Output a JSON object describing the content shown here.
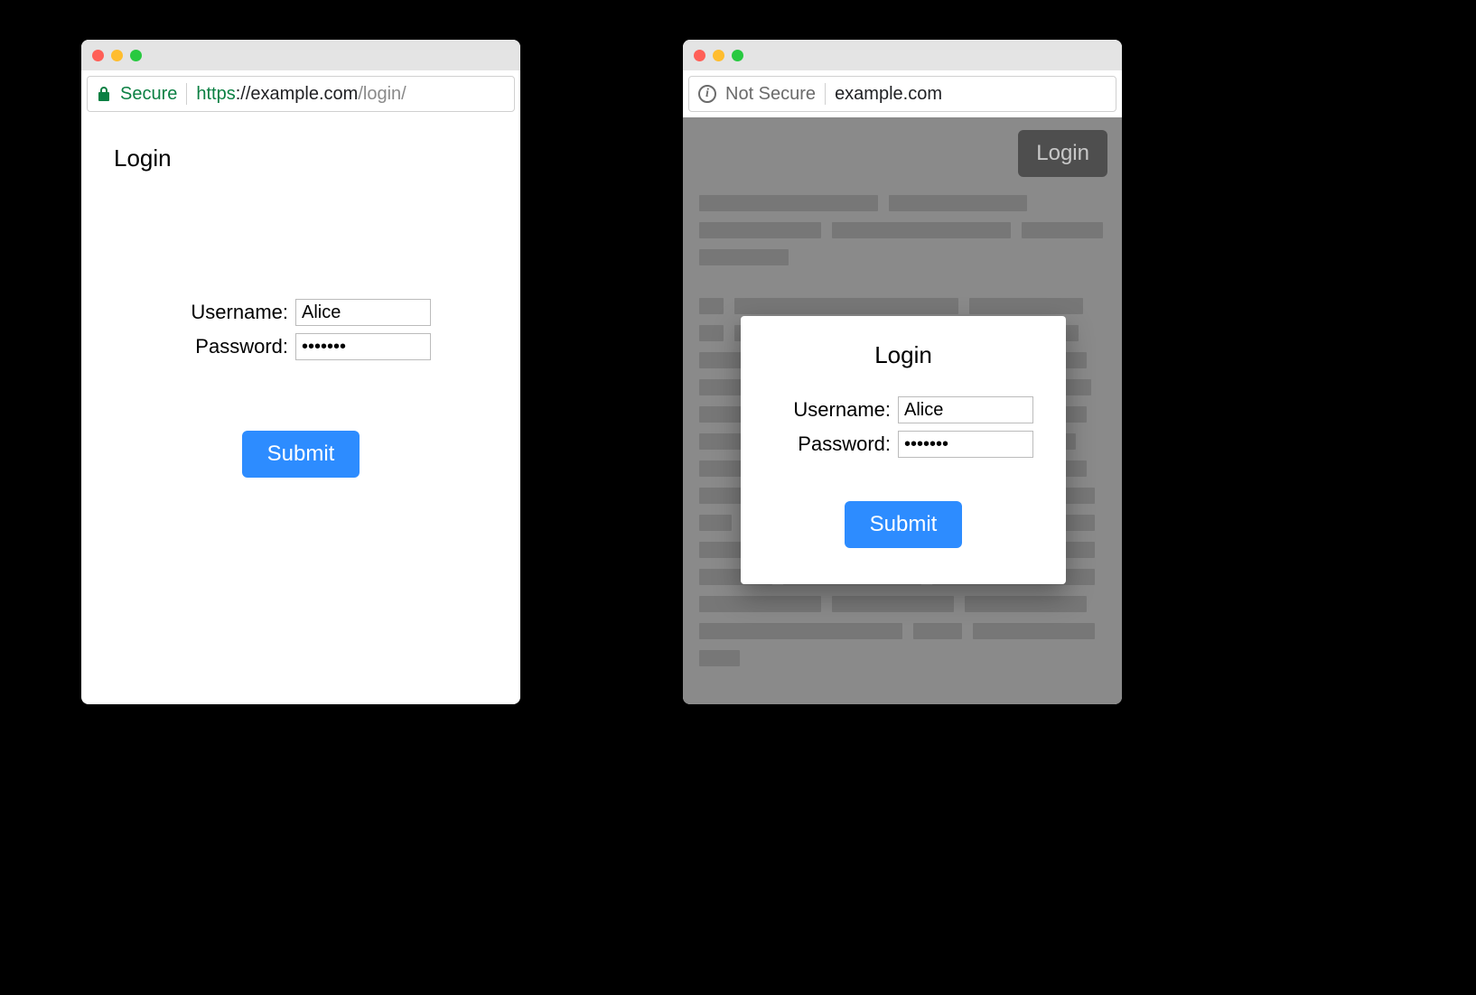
{
  "left": {
    "secure_label": "Secure",
    "url_scheme": "https",
    "url_host": "://example.com",
    "url_path": "/login/",
    "page_title": "Login",
    "username_label": "Username:",
    "username_value": "Alice",
    "password_label": "Password:",
    "password_value": "•••••••",
    "submit_label": "Submit"
  },
  "right": {
    "notsecure_label": "Not Secure",
    "url": "example.com",
    "login_button": "Login",
    "modal": {
      "title": "Login",
      "username_label": "Username:",
      "username_value": "Alice",
      "password_label": "Password:",
      "password_value": "•••••••",
      "submit_label": "Submit"
    }
  },
  "colors": {
    "secure_green": "#0b8043",
    "submit_blue": "#2d8cff"
  }
}
